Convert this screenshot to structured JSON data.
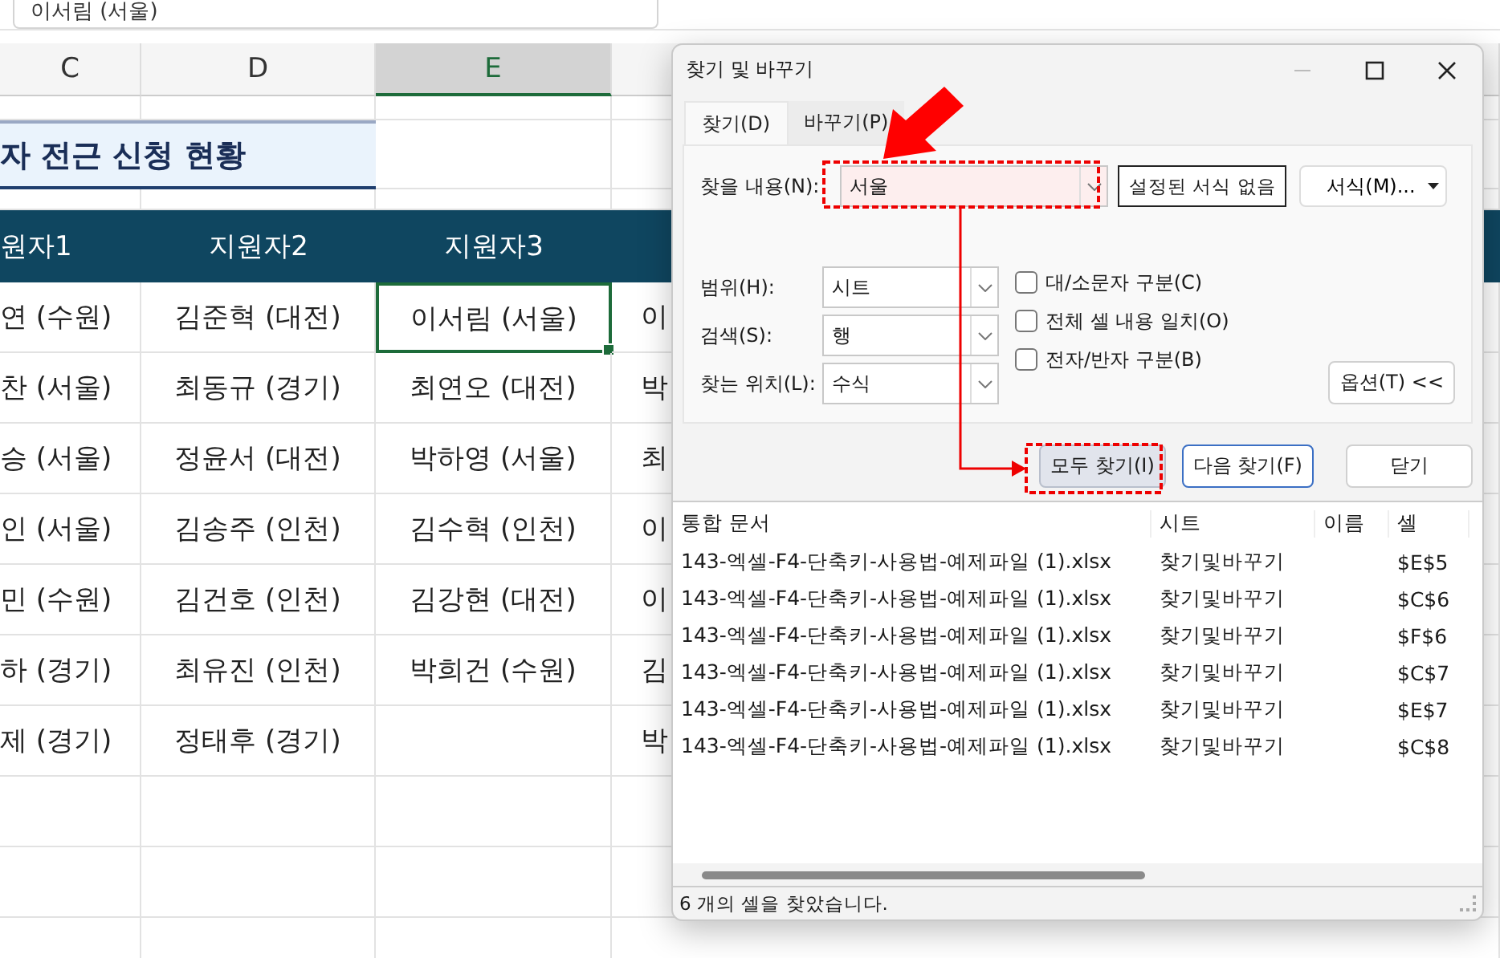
{
  "formula_bar": {
    "value": "이서림 (서울)"
  },
  "sheet": {
    "columns": [
      {
        "label": "C",
        "selected": false
      },
      {
        "label": "D",
        "selected": false
      },
      {
        "label": "E",
        "selected": true
      }
    ],
    "title": "자 전근 신청 현황",
    "header": [
      "원자1",
      "지원자2",
      "지원자3"
    ],
    "rows": [
      {
        "cells": [
          {
            "text": "연 (수원)",
            "selected": false
          },
          {
            "text": "김준혁 (대전)",
            "selected": false
          },
          {
            "text": "이서림 (서울)",
            "selected": true
          },
          {
            "text": "이",
            "selected": false
          }
        ]
      },
      {
        "cells": [
          {
            "text": "찬 (서울)",
            "selected": false
          },
          {
            "text": "최동규 (경기)",
            "selected": false
          },
          {
            "text": "최연오 (대전)",
            "selected": false
          },
          {
            "text": "박",
            "selected": false
          }
        ]
      },
      {
        "cells": [
          {
            "text": "승 (서울)",
            "selected": false
          },
          {
            "text": "정윤서 (대전)",
            "selected": false
          },
          {
            "text": "박하영 (서울)",
            "selected": false
          },
          {
            "text": "최",
            "selected": false
          }
        ]
      },
      {
        "cells": [
          {
            "text": "인 (서울)",
            "selected": false
          },
          {
            "text": "김송주 (인천)",
            "selected": false
          },
          {
            "text": "김수혁 (인천)",
            "selected": false
          },
          {
            "text": "이",
            "selected": false
          }
        ]
      },
      {
        "cells": [
          {
            "text": "민 (수원)",
            "selected": false
          },
          {
            "text": "김건호 (인천)",
            "selected": false
          },
          {
            "text": "김강현 (대전)",
            "selected": false
          },
          {
            "text": "이",
            "selected": false
          }
        ]
      },
      {
        "cells": [
          {
            "text": "하 (경기)",
            "selected": false
          },
          {
            "text": "최유진 (인천)",
            "selected": false
          },
          {
            "text": "박희건 (수원)",
            "selected": false
          },
          {
            "text": "김",
            "selected": false
          }
        ]
      },
      {
        "cells": [
          {
            "text": "제 (경기)",
            "selected": false
          },
          {
            "text": "정태후 (경기)",
            "selected": false
          },
          {
            "selected": false
          },
          {
            "text": "박",
            "selected": false
          }
        ]
      }
    ]
  },
  "dialog": {
    "title": "찾기 및 바꾸기",
    "tabs": [
      {
        "label": "찾기(D)",
        "selected": true
      },
      {
        "label": "바꾸기(P)",
        "selected": false
      }
    ],
    "find": {
      "label": "찾을 내용(N):",
      "value": "서울"
    },
    "format_preview": "설정된 서식 없음",
    "format_button": "서식(M)...",
    "options": [
      {
        "label": "범위(H):",
        "value": "시트"
      },
      {
        "label": "검색(S):",
        "value": "행"
      },
      {
        "label": "찾는 위치(L):",
        "value": "수식"
      }
    ],
    "checkboxes": [
      {
        "label": "대/소문자 구분(C)",
        "checked": false
      },
      {
        "label": "전체 셀 내용 일치(O)",
        "checked": false
      },
      {
        "label": "전자/반자 구분(B)",
        "checked": false
      }
    ],
    "options_button": "옵션(T) <<",
    "buttons": [
      {
        "label": "모두 찾기(I)",
        "pressed": true,
        "focused": false
      },
      {
        "label": "다음 찾기(F)",
        "pressed": false,
        "focused": true
      },
      {
        "label": "닫기",
        "pressed": false,
        "focused": false
      }
    ],
    "results": {
      "columns": [
        "통합 문서",
        "시트",
        "이름",
        "셀"
      ],
      "rows": [
        {
          "workbook": "143-엑셀-F4-단축키-사용법-예제파일 (1).xlsx",
          "sheet": "찾기및바꾸기",
          "cell": "$E$5"
        },
        {
          "workbook": "143-엑셀-F4-단축키-사용법-예제파일 (1).xlsx",
          "sheet": "찾기및바꾸기",
          "cell": "$C$6"
        },
        {
          "workbook": "143-엑셀-F4-단축키-사용법-예제파일 (1).xlsx",
          "sheet": "찾기및바꾸기",
          "cell": "$F$6"
        },
        {
          "workbook": "143-엑셀-F4-단축키-사용법-예제파일 (1).xlsx",
          "sheet": "찾기및바꾸기",
          "cell": "$C$7"
        },
        {
          "workbook": "143-엑셀-F4-단축키-사용법-예제파일 (1).xlsx",
          "sheet": "찾기및바꾸기",
          "cell": "$E$7"
        },
        {
          "workbook": "143-엑셀-F4-단축키-사용법-예제파일 (1).xlsx",
          "sheet": "찾기및바꾸기",
          "cell": "$C$8"
        }
      ]
    },
    "status": "6 개의 셀을 찾았습니다."
  },
  "annotations": {
    "pointer_arrow": true,
    "field_highlight": true,
    "button_highlight": true,
    "connector": true
  }
}
